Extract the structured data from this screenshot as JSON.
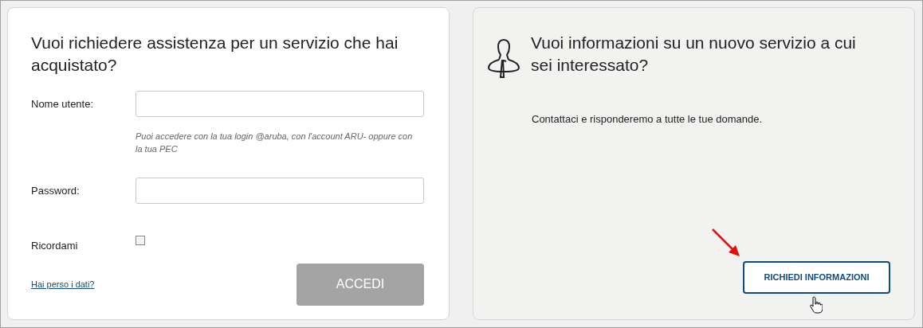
{
  "login_panel": {
    "title": "Vuoi richiedere assistenza per un servizio che hai acquistato?",
    "fields": [
      {
        "label": "Nome utente:",
        "hint": "Puoi accedere con la tua login @aruba, con l'account ARU- oppure con la tua PEC"
      },
      {
        "label": "Password:"
      }
    ],
    "remember": {
      "label": "Ricordami",
      "checked": false
    },
    "forgot_link": "Hai perso i dati?",
    "submit": {
      "label": "ACCEDI",
      "disabled": true
    }
  },
  "info_panel": {
    "title": "Vuoi informazioni su un nuovo servizio a cui sei interessato?",
    "text": "Contattaci e risponderemo a tutte le tue domande.",
    "button": {
      "label": "RICHIEDI INFORMAZIONI"
    }
  }
}
